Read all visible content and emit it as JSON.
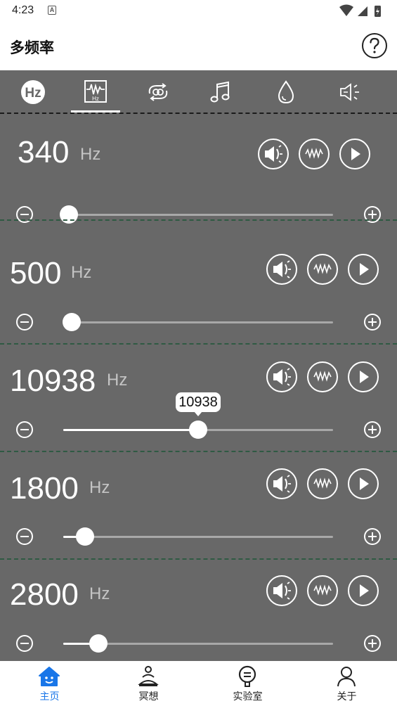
{
  "status": {
    "time": "4:23",
    "notification": "A"
  },
  "app": {
    "title": "多频率"
  },
  "tabs": [
    {
      "icon": "hz-icon",
      "active": false
    },
    {
      "icon": "waveform-hz-icon",
      "active": true
    },
    {
      "icon": "loop-icon",
      "active": false
    },
    {
      "icon": "music-note-icon",
      "active": false
    },
    {
      "icon": "droplet-icon",
      "active": false
    },
    {
      "icon": "speaker-icon",
      "active": false
    }
  ],
  "cards": [
    {
      "frequency": "340",
      "unit": "Hz",
      "slider_fraction": 0.02,
      "tooltip": ""
    },
    {
      "frequency": "500",
      "unit": "Hz",
      "slider_fraction": 0.03,
      "tooltip": ""
    },
    {
      "frequency": "10938",
      "unit": "Hz",
      "slider_fraction": 0.5,
      "tooltip": "10938"
    },
    {
      "frequency": "1800",
      "unit": "Hz",
      "slider_fraction": 0.08,
      "tooltip": ""
    },
    {
      "frequency": "2800",
      "unit": "Hz",
      "slider_fraction": 0.13,
      "tooltip": ""
    }
  ],
  "nav": [
    {
      "label": "主页",
      "icon": "home-icon",
      "active": true
    },
    {
      "label": "冥想",
      "icon": "meditation-icon",
      "active": false
    },
    {
      "label": "实验室",
      "icon": "lab-icon",
      "active": false
    },
    {
      "label": "关于",
      "icon": "person-icon",
      "active": false
    }
  ],
  "colors": {
    "accent": "#1976e8",
    "panel": "#686868",
    "divider": "#2f5a43"
  }
}
